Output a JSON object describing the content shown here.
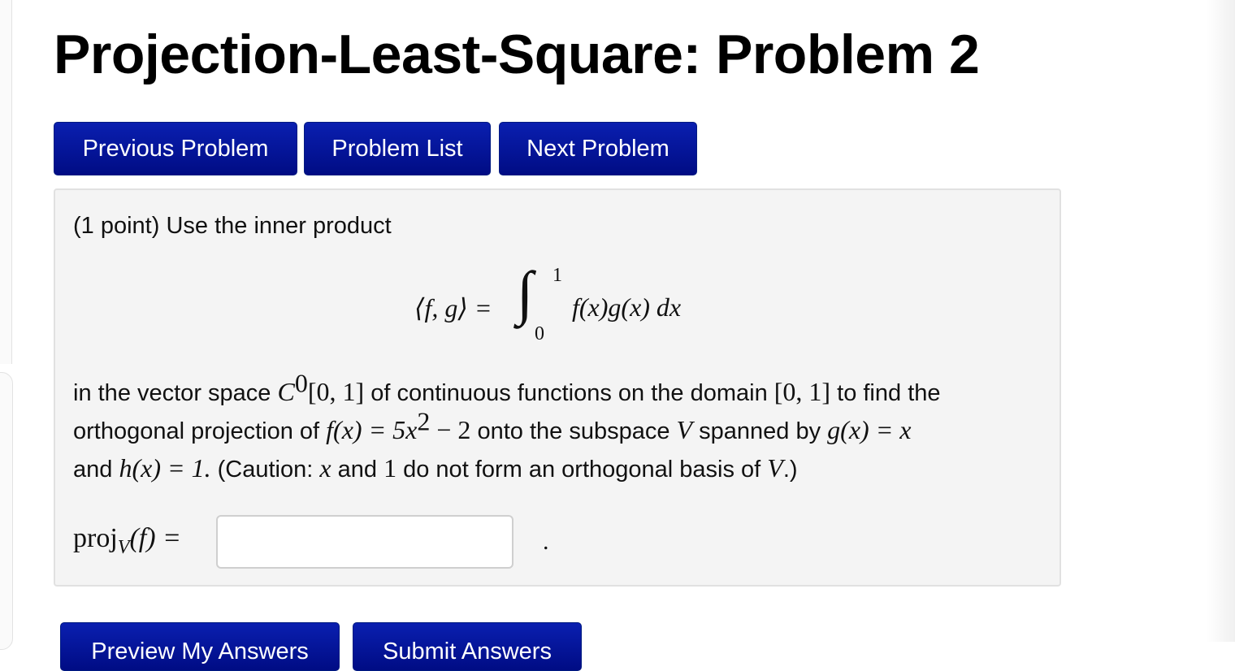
{
  "page": {
    "title": "Projection-Least-Square: Problem 2"
  },
  "nav": {
    "previous_label": "Previous Problem",
    "list_label": "Problem List",
    "next_label": "Next Problem"
  },
  "problem": {
    "intro": "(1 point) Use the inner product",
    "formula": {
      "lhs": "⟨f, g⟩ =",
      "integral": "∫",
      "upper_limit": "1",
      "lower_limit": "0",
      "integrand": "f(x)g(x) dx"
    },
    "para": {
      "t1": "in the vector space ",
      "m_space_base": "C",
      "m_space_sup": "0",
      "m_space_interval": "[0, 1]",
      "t2": " of continuous functions on the domain ",
      "m_domain": "[0, 1]",
      "t3": " to find the orthogonal projection of ",
      "m_f_lhs": "f(x) = 5x",
      "m_f_sup": "2",
      "m_f_rest": " − 2",
      "t4": " onto the subspace ",
      "m_V": "V",
      "t5": " spanned by ",
      "m_g": "g(x) = x",
      "t6": " and ",
      "m_h": "h(x) = 1.",
      "t7": " (Caution: ",
      "m_x": "x",
      "t8": " and ",
      "m_one": "1",
      "t9": " do not form an orthogonal basis of ",
      "m_V2": "V",
      "t10": ".)"
    },
    "answer": {
      "label_proj": "proj",
      "label_sub": "V",
      "label_rest": "(f) =",
      "value": "",
      "placeholder": "",
      "period": "."
    }
  },
  "bottom_buttons": {
    "preview_label": "Preview My Answers",
    "submit_label": "Submit Answers"
  }
}
